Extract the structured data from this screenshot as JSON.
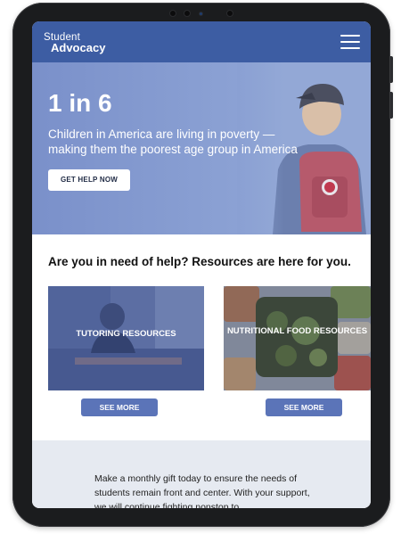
{
  "header": {
    "brand_line1": "Student",
    "brand_line2": "Advocacy"
  },
  "hero": {
    "headline": "1 in 6",
    "subtext": "Children in America are living in poverty — making them the poorest age group in America",
    "cta_label": "GET HELP NOW"
  },
  "resources": {
    "title": "Are you in need of help? Resources are here for you.",
    "cards": [
      {
        "label": "TUTORING RESOURCES",
        "button": "SEE MORE"
      },
      {
        "label": "NUTRITIONAL FOOD RESOURCES",
        "button": "SEE MORE"
      }
    ]
  },
  "gift": {
    "text": "Make a monthly gift today to ensure the needs of students remain front and center. With your support, we will continue fighting nonstop to"
  },
  "colors": {
    "brand_blue": "#3d5da3",
    "hero_tint": "#7a90ca",
    "button_blue": "#5b74b8",
    "gift_bg": "#e6eaf1"
  }
}
